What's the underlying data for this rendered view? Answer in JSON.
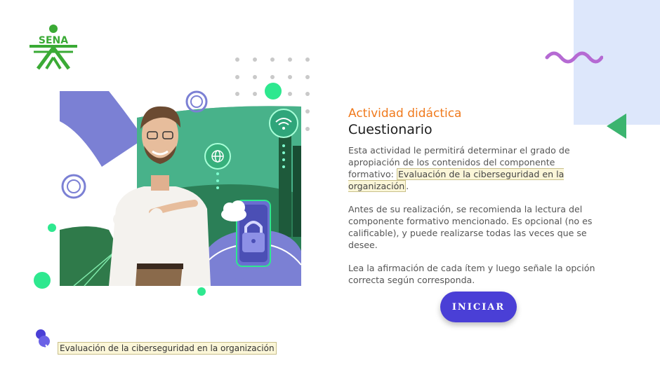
{
  "brand": {
    "logo_text": "SENA",
    "green": "#3aaa35"
  },
  "activity": {
    "subtitle": "Actividad didáctica",
    "title": "Cuestionario",
    "intro": "Esta actividad le permitirá determinar el grado de apropiación de los contenidos del componente formativo:",
    "component_name": "Evaluación de la ciberseguridad en la organización",
    "intro_end": ".",
    "recommendation": "Antes de su realización, se recomienda la lectura del componente formativo mencionado.  Es opcional (no es calificable), y puede realizarse todas las veces que se desee.",
    "instruction": "Lea la afirmación de cada ítem y luego señale la opción correcta según corresponda."
  },
  "start_button": {
    "label": "INICIAR",
    "color": "#4a3fd6"
  },
  "footer": {
    "label": "Evaluación de la ciberseguridad en la organización"
  },
  "icons": {
    "pin": "pushpin-icon",
    "wifi": "wifi-icon",
    "globe": "globe-icon",
    "lock": "padlock-icon",
    "cloud": "cloud-icon"
  },
  "colors": {
    "subtitle": "#f07a1d",
    "accent_green": "#2ee88f",
    "accent_purple": "#7b80d4",
    "wave": "#b56ad3",
    "panel": "#dde7fb"
  }
}
